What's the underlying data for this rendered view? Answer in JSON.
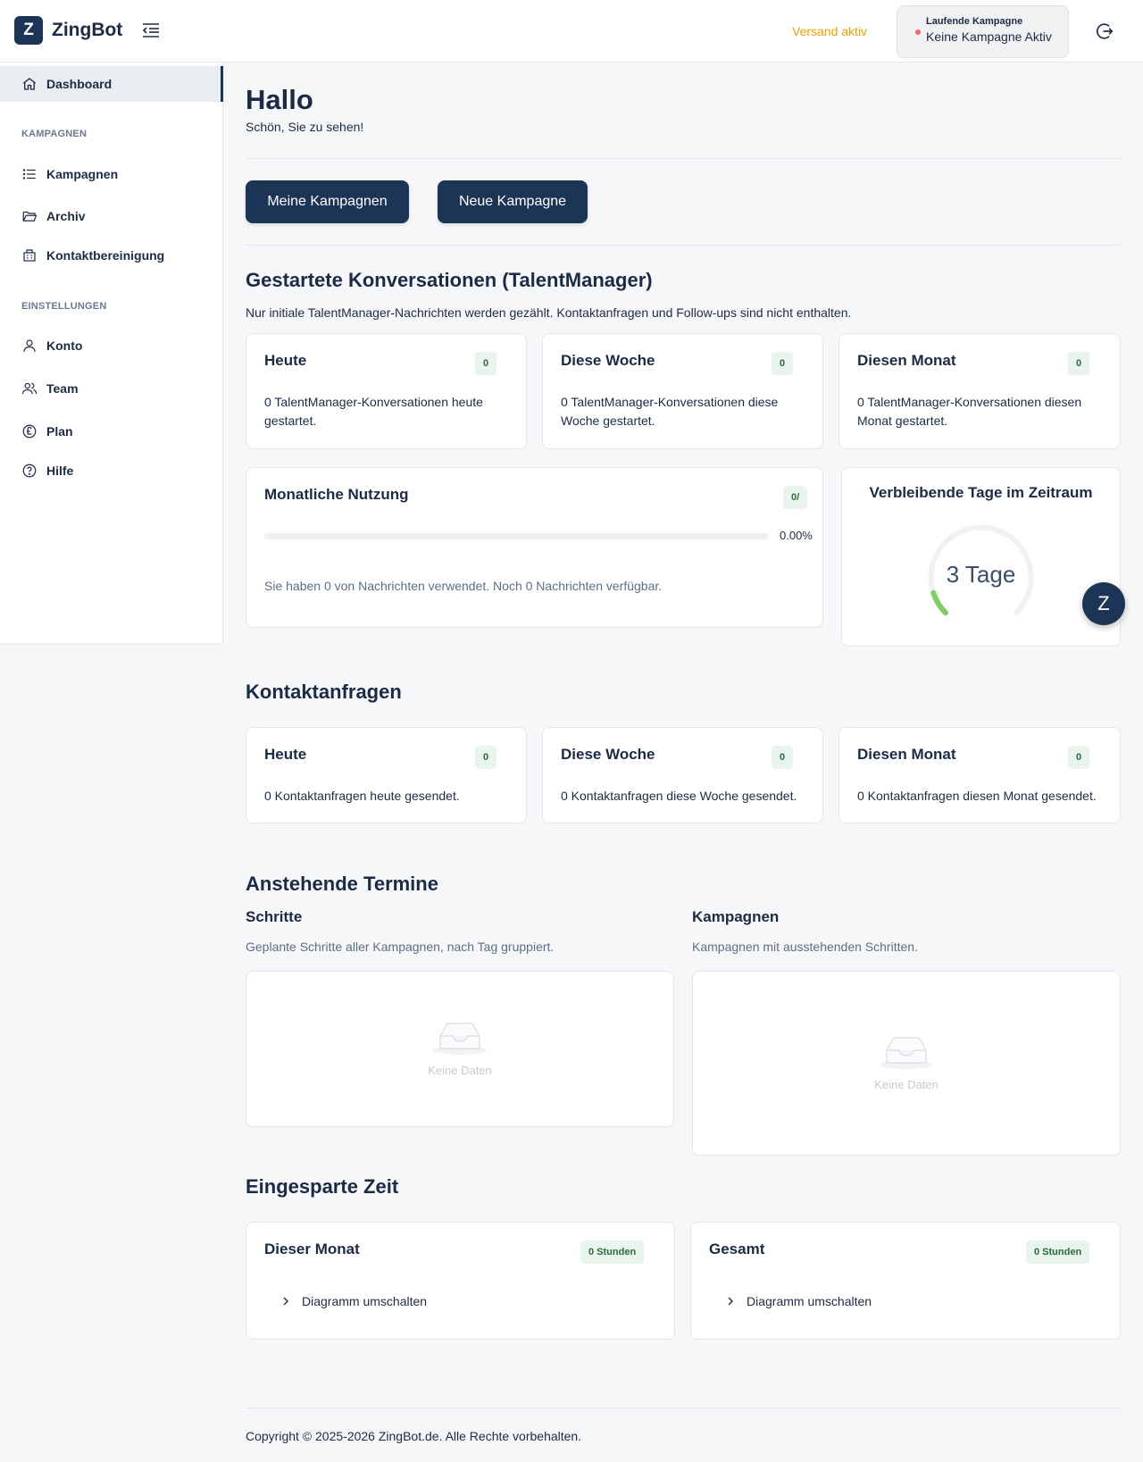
{
  "header": {
    "logo_letter": "Z",
    "app_name": "ZingBot",
    "status": "Versand aktiv",
    "campaign_label": "Laufende Kampagne",
    "campaign_value": "Keine Kampagne Aktiv"
  },
  "sidebar": {
    "dashboard": "Dashboard",
    "section_campaigns": "KAMPAGNEN",
    "campaigns": "Kampagnen",
    "archive": "Archiv",
    "contact_cleanup": "Kontaktbereinigung",
    "section_settings": "EINSTELLUNGEN",
    "account": "Konto",
    "team": "Team",
    "plan": "Plan",
    "help": "Hilfe"
  },
  "main": {
    "title": "Hallo",
    "subtitle": "Schön, Sie zu sehen!",
    "btn_my_campaigns": "Meine Kampagnen",
    "btn_new_campaign": "Neue Kampagne",
    "conv": {
      "title": "Gestartete Konversationen (TalentManager)",
      "note": "Nur initiale TalentManager-Nachrichten werden gezählt. Kontaktanfragen und Follow-ups sind nicht enthalten.",
      "cards": [
        {
          "title": "Heute",
          "badge": "0",
          "text": "0 TalentManager-Konversationen heute gestartet."
        },
        {
          "title": "Diese Woche",
          "badge": "0",
          "text": "0 TalentManager-Konversationen diese Woche gestartet."
        },
        {
          "title": "Diesen Monat",
          "badge": "0",
          "text": "0 TalentManager-Konversationen diesen Monat gestartet."
        }
      ]
    },
    "usage": {
      "title": "Monatliche Nutzung",
      "badge": "0/",
      "percent_label": "0.00%",
      "percent": 0,
      "text": "Sie haben 0 von Nachrichten verwendet. Noch 0 Nachrichten verfügbar."
    },
    "remaining": {
      "title": "Verbleibende Tage im Zeitraum",
      "value": "3 Tage",
      "fraction": 0.1
    },
    "contacts": {
      "title": "Kontaktanfragen",
      "cards": [
        {
          "title": "Heute",
          "badge": "0",
          "text": "0 Kontaktanfragen heute gesendet."
        },
        {
          "title": "Diese Woche",
          "badge": "0",
          "text": "0 Kontaktanfragen diese Woche gesendet."
        },
        {
          "title": "Diesen Monat",
          "badge": "0",
          "text": "0 Kontaktanfragen diesen Monat gesendet."
        }
      ]
    },
    "upcoming": {
      "title": "Anstehende Termine",
      "steps_title": "Schritte",
      "steps_desc": "Geplante Schritte aller Kampagnen, nach Tag gruppiert.",
      "campaigns_title": "Kampagnen",
      "campaigns_desc": "Kampagnen mit ausstehenden Schritten.",
      "empty": "Keine Daten"
    },
    "saved": {
      "title": "Eingesparte Zeit",
      "month_title": "Dieser Monat",
      "month_badge": "0 Stunden",
      "total_title": "Gesamt",
      "total_badge": "0 Stunden",
      "toggle": "Diagramm umschalten"
    },
    "fab_letter": "Z",
    "footer": "Copyright © 2025-2026 ZingBot.de. Alle Rechte vorbehalten."
  },
  "colors": {
    "primary": "#1c3557",
    "status_orange": "#f5a000",
    "badge_bg": "#e9f5ec",
    "gauge_green": "#7dcf62"
  }
}
